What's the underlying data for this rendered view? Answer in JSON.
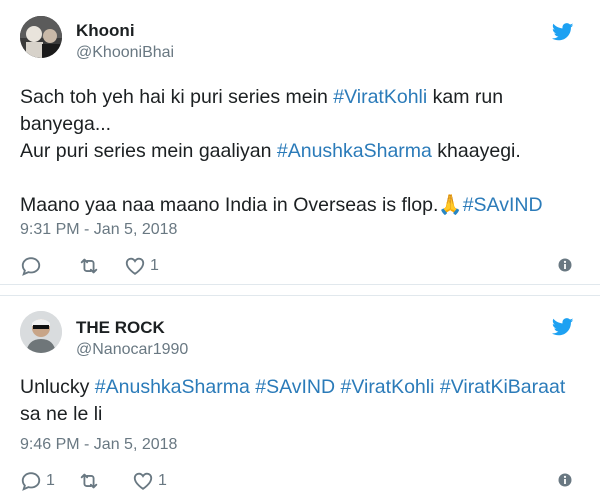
{
  "colors": {
    "link": "#2b7bb9",
    "muted": "#697882",
    "brand": "#1da1f2",
    "text": "#1c2022"
  },
  "tweets": [
    {
      "name": "Khooni",
      "handle": "@KhooniBhai",
      "line1": "Sach toh yeh hai ki puri series mein ",
      "tag1": "#ViratKohli",
      "line1b": " kam run",
      "line2": "banyega...",
      "line3": "Aur puri series mein gaaliyan ",
      "tag2": "#AnushkaSharma",
      "line3b": " khaayegi.",
      "line4": "Maano yaa naa maano India in Overseas is flop.",
      "emoji": "🙏",
      "tag3": "#SAvIND",
      "time": "9:31 PM - Jan 5, 2018",
      "reply_count": "",
      "retweet_count": "",
      "like_count": "1"
    },
    {
      "name": "THE ROCK",
      "handle": "@Nanocar1990",
      "line1": "Unlucky ",
      "tag1": "#AnushkaSharma",
      "tag2": "#SAvIND",
      "tag3": "#ViratKohli",
      "tag4": "#ViratKiBaraat",
      "line2": "sa ne le li",
      "time": "9:46 PM - Jan 5, 2018",
      "reply_count": "1",
      "retweet_count": "",
      "like_count": "1"
    }
  ],
  "icons": [
    "twitter-bird-icon",
    "reply-icon",
    "retweet-icon",
    "like-icon",
    "info-icon"
  ]
}
